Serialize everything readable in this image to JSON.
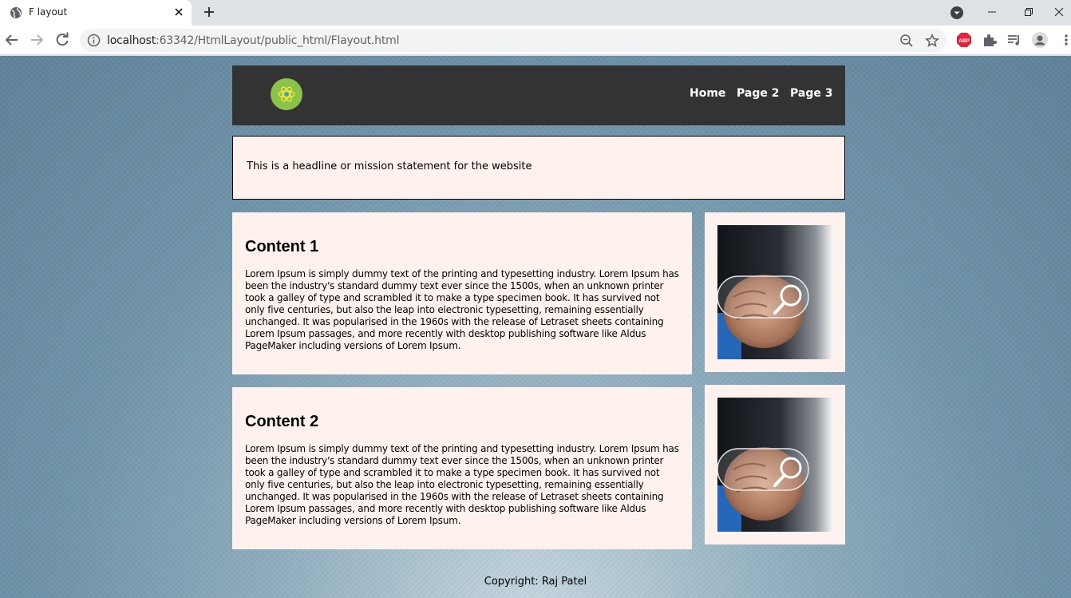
{
  "browser": {
    "tab_title": "F layout",
    "url_host": "localhost",
    "url_rest": ":63342/HtmlLayout/public_html/Flayout.html"
  },
  "site": {
    "nav": [
      "Home",
      "Page 2",
      "Page 3"
    ],
    "headline": "This is a headline or mission statement for the website",
    "sections": [
      {
        "title": "Content 1",
        "body": "Lorem Ipsum is simply dummy text of the printing and typesetting industry. Lorem Ipsum has been the industry's standard dummy text ever since the 1500s, when an unknown printer took a galley of type and scrambled it to make a type specimen book. It has survived not only five centuries, but also the leap into electronic typesetting, remaining essentially unchanged. It was popularised in the 1960s with the release of Letraset sheets containing Lorem Ipsum passages, and more recently with desktop publishing software like Aldus PageMaker including versions of Lorem Ipsum."
      },
      {
        "title": "Content 2",
        "body": "Lorem Ipsum is simply dummy text of the printing and typesetting industry. Lorem Ipsum has been the industry's standard dummy text ever since the 1500s, when an unknown printer took a galley of type and scrambled it to make a type specimen book. It has survived not only five centuries, but also the leap into electronic typesetting, remaining essentially unchanged. It was popularised in the 1960s with the release of Letraset sheets containing Lorem Ipsum passages, and more recently with desktop publishing software like Aldus PageMaker including versions of Lorem Ipsum."
      }
    ],
    "footer": "Copyright: Raj Patel"
  },
  "icons": [
    "globe-icon",
    "close-icon",
    "plus-icon",
    "back-icon",
    "forward-icon",
    "reload-icon",
    "info-icon",
    "zoom-icon",
    "star-icon",
    "adblock-icon",
    "puzzle-icon",
    "media-icon",
    "profile-icon",
    "menu-icon"
  ],
  "colors": {
    "header_bg": "#333333",
    "panel_bg": "#fff2ee",
    "logo": "#8bc34a"
  }
}
